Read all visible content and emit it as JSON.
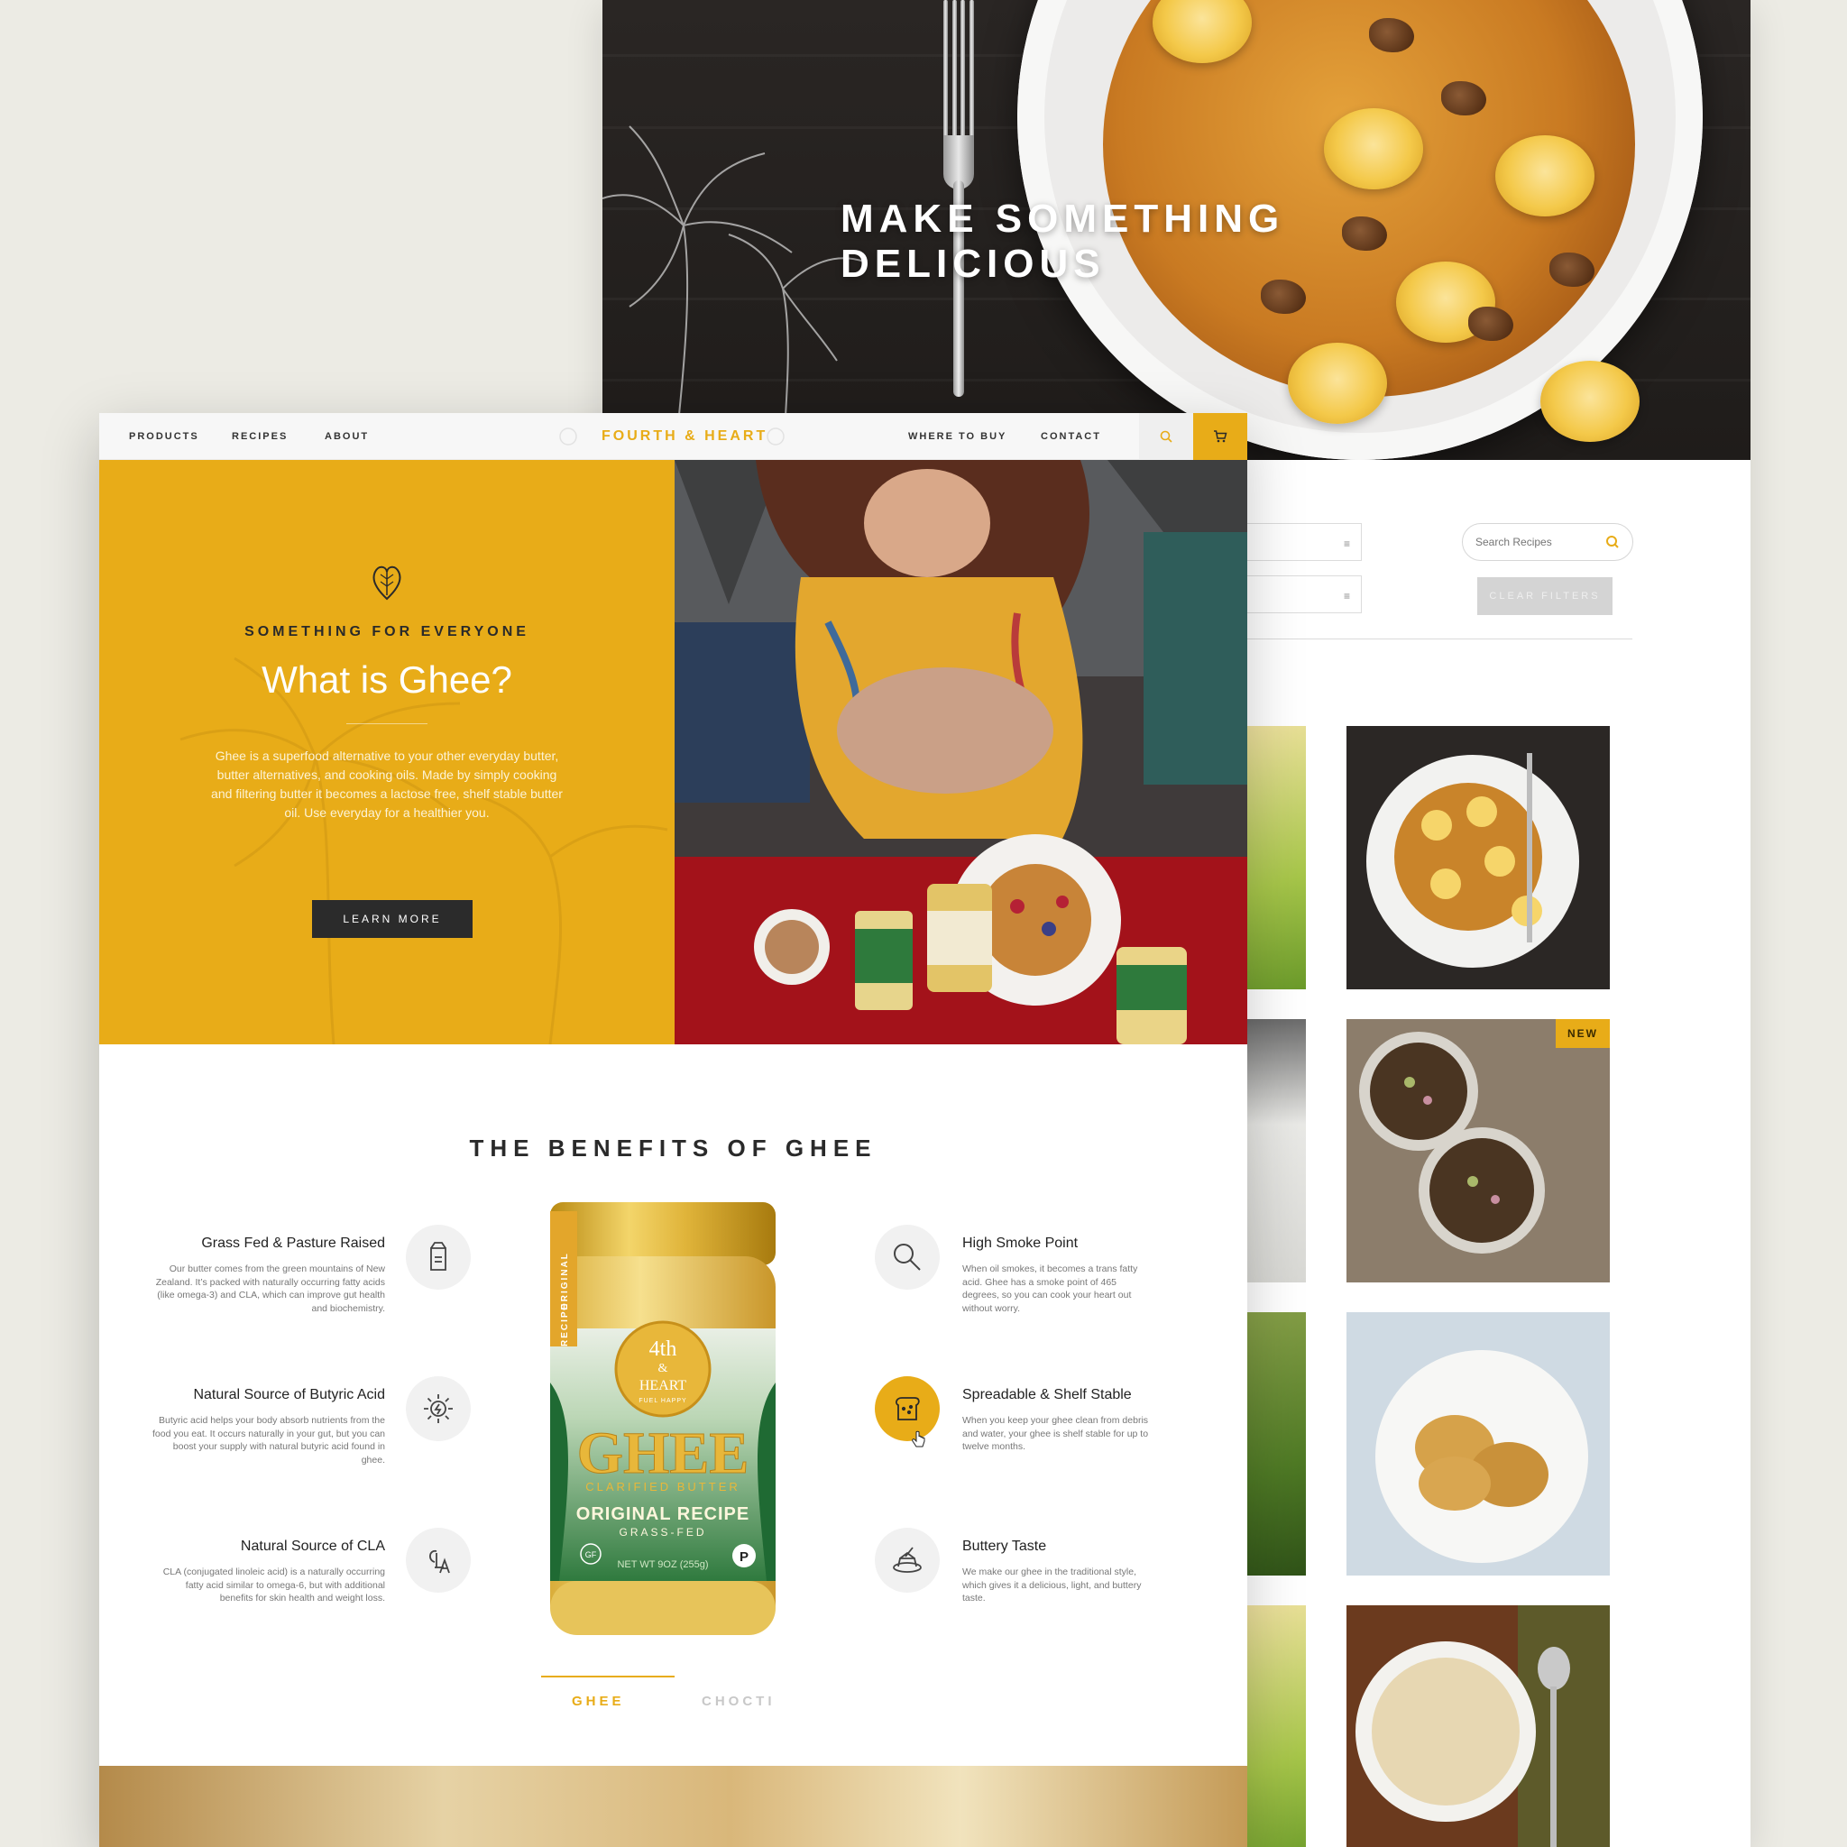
{
  "hero": {
    "title": "MAKE SOMETHING DELICIOUS"
  },
  "filters": {
    "search_placeholder": "Search Recipes",
    "clear_label": "CLEAR FILTERS"
  },
  "recipes": {
    "new_badge": "NEW"
  },
  "nav": {
    "products": "PRODUCTS",
    "recipes": "RECIPES",
    "about": "ABOUT",
    "logo": "FOURTH & HEART",
    "where_to_buy": "WHERE TO BUY",
    "contact": "CONTACT"
  },
  "intro": {
    "kicker": "SOMETHING FOR EVERYONE",
    "title": "What is Ghee?",
    "body": "Ghee is a superfood alternative to your other everyday butter, butter alternatives, and cooking oils. Made by simply cooking and filtering butter it becomes a lactose free, shelf stable butter oil. Use everyday for a healthier you.",
    "cta": "LEARN MORE"
  },
  "benefits": {
    "title": "THE BENEFITS OF GHEE",
    "left": [
      {
        "title": "Grass Fed & Pasture Raised",
        "text": "Our butter comes from the green mountains of New Zealand. It’s packed with naturally occurring fatty acids (like omega-3) and CLA, which can improve gut health and biochemistry.",
        "icon": "milk-carton-icon"
      },
      {
        "title": "Natural Source of Butyric Acid",
        "text": "Butyric acid helps your body absorb nutrients from the food you eat. It occurs naturally in your gut, but you can boost your supply with natural butyric acid found in ghee.",
        "icon": "energy-sun-icon"
      },
      {
        "title": "Natural Source of CLA",
        "text": "CLA (conjugated linoleic acid) is a naturally occurring fatty acid similar to omega-6, but with additional benefits for skin health and weight loss.",
        "icon": "cla-icon"
      }
    ],
    "right": [
      {
        "title": "High Smoke Point",
        "text": "When oil smokes, it becomes a trans fatty acid. Ghee has a smoke point of 465 degrees, so you can cook your heart out without worry.",
        "icon": "frying-pan-icon"
      },
      {
        "title": "Spreadable & Shelf Stable",
        "text": "When you keep your ghee clean from debris and water, your ghee is shelf stable for up to twelve months.",
        "icon": "toast-icon"
      },
      {
        "title": "Buttery Taste",
        "text": "We make our ghee in the traditional style, which gives it a delicious, light, and buttery taste.",
        "icon": "butter-dish-icon"
      }
    ]
  },
  "jar": {
    "side_label_1": "ORIGINAL",
    "side_label_2": "RECIPE",
    "brand_line_1": "4th",
    "brand_line_2": "&",
    "brand_line_3": "HEART",
    "brand_tag": "FUEL HAPPY",
    "product": "GHEE",
    "subtitle": "CLARIFIED BUTTER",
    "variant": "ORIGINAL RECIPE",
    "variant_sub": "GRASS-FED",
    "net_wt": "NET WT 9OZ (255g)",
    "badge_gf": "GF",
    "badge_p": "P"
  },
  "tabs": {
    "ghee": "GHEE",
    "chocti": "CHOCTI"
  },
  "colors": {
    "accent": "#e8ac18",
    "dark": "#2b2b2b"
  }
}
